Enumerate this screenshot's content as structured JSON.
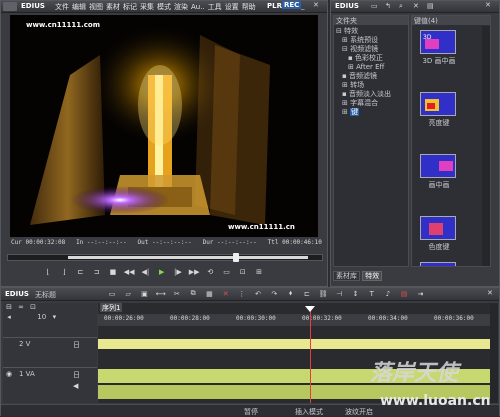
{
  "player": {
    "logo": "EDIUS",
    "menu": [
      "文件",
      "编辑",
      "视图",
      "素材",
      "标记",
      "采集",
      "模式",
      "渲染",
      "Au..",
      "工具",
      "设置",
      "帮助"
    ],
    "plr": "PLR",
    "rec": "REC",
    "watermark_top": "www.cn11111.com",
    "watermark_bottom": "www.cn11111.cn",
    "tc": {
      "cur_label": "Cur",
      "cur": "00:00:32:08",
      "in_label": "In",
      "in": "--:--:--:--",
      "out_label": "Out",
      "out": "--:--:--:--",
      "dur_label": "Dur",
      "dur": "--:--:--:--",
      "ttl_label": "Ttl",
      "ttl": "00:00:46:10"
    }
  },
  "effects": {
    "logo": "EDIUS",
    "header": "文件夹",
    "tree": [
      "特效",
      "系统预设",
      "视频滤镜",
      "色彩校正",
      "After Eff",
      "音频滤镜",
      "转场",
      "音频淡入淡出",
      "字幕混合",
      "键"
    ],
    "right_header": "键值(4)",
    "items": [
      "3D 画中画",
      "亮度键",
      "画中画",
      "色度键"
    ],
    "tabs": [
      "素材库",
      "特效"
    ]
  },
  "timeline": {
    "logo": "EDIUS",
    "project": "无标题",
    "sequence": "序列1",
    "counter": "10",
    "ruler": [
      "00:00:26:00",
      "00:00:28:00",
      "00:00:30:00",
      "00:00:32:00",
      "00:00:34:00",
      "00:00:36:00"
    ],
    "tracks": [
      {
        "name": "2 V",
        "flag": "日"
      },
      {
        "name": "1 VA",
        "flag": "日"
      }
    ]
  },
  "status": {
    "pause": "暂停",
    "insert": "插入模式",
    "ripple": "波纹开启"
  },
  "corner": {
    "text": "落岸天使",
    "url": "www.luoan.cn"
  }
}
